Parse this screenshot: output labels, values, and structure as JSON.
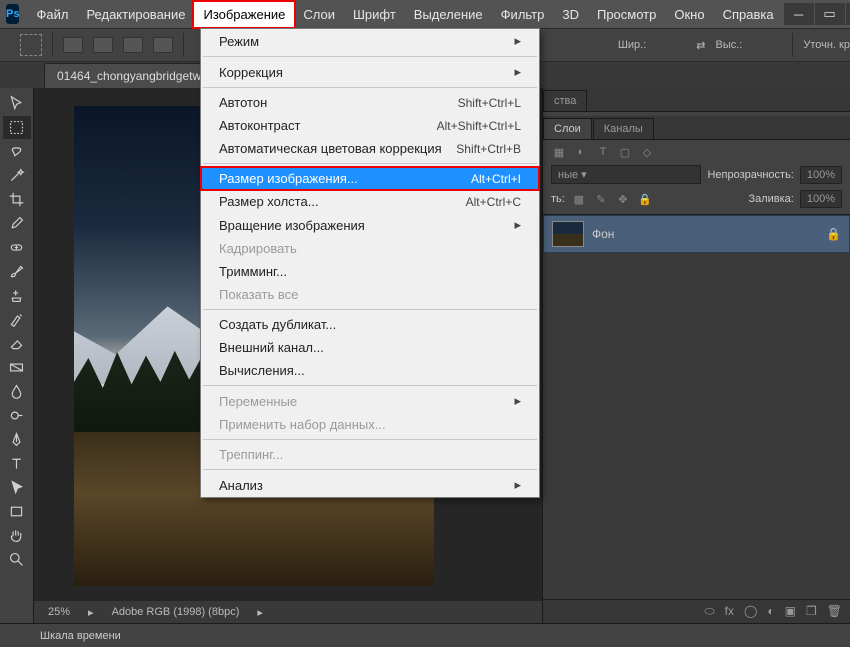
{
  "menubar": {
    "items": [
      "Файл",
      "Редактирование",
      "Изображение",
      "Слои",
      "Шрифт",
      "Выделение",
      "Фильтр",
      "3D",
      "Просмотр",
      "Окно",
      "Справка"
    ],
    "open_index": 2
  },
  "optbar": {
    "width_label": "Шир.:",
    "height_label": "Выс.:",
    "refine_label": "Уточн. кр"
  },
  "document": {
    "tab_title": "01464_chongyangbridgetw...",
    "zoom": "25%",
    "profile": "Adobe RGB (1998) (8bpc)"
  },
  "dropdown": {
    "items": [
      {
        "label": "Режим",
        "submenu": true
      },
      "sep",
      {
        "label": "Коррекция",
        "submenu": true
      },
      "sep",
      {
        "label": "Автотон",
        "shortcut": "Shift+Ctrl+L"
      },
      {
        "label": "Автоконтраст",
        "shortcut": "Alt+Shift+Ctrl+L"
      },
      {
        "label": "Автоматическая цветовая коррекция",
        "shortcut": "Shift+Ctrl+B"
      },
      "sep",
      {
        "label": "Размер изображения...",
        "shortcut": "Alt+Ctrl+I",
        "highlight": true
      },
      {
        "label": "Размер холста...",
        "shortcut": "Alt+Ctrl+C"
      },
      {
        "label": "Вращение изображения",
        "submenu": true
      },
      {
        "label": "Кадрировать",
        "disabled": true
      },
      {
        "label": "Тримминг..."
      },
      {
        "label": "Показать все",
        "disabled": true
      },
      "sep",
      {
        "label": "Создать дубликат..."
      },
      {
        "label": "Внешний канал..."
      },
      {
        "label": "Вычисления..."
      },
      "sep",
      {
        "label": "Переменные",
        "submenu": true,
        "disabled": true
      },
      {
        "label": "Применить набор данных...",
        "disabled": true
      },
      "sep",
      {
        "label": "Треппинг...",
        "disabled": true
      },
      "sep",
      {
        "label": "Анализ",
        "submenu": true
      }
    ]
  },
  "panels": {
    "props_tab": "ства",
    "layers_tab": "Слои",
    "channels_tab": "Каналы",
    "blend_mode": "ные",
    "opacity_label": "Непрозрачность:",
    "opacity_value": "100%",
    "lock_label": "ть:",
    "fill_label": "Заливка:",
    "fill_value": "100%",
    "bg_layer": "Фон"
  },
  "status": {
    "timeline": "Шкала времени"
  }
}
